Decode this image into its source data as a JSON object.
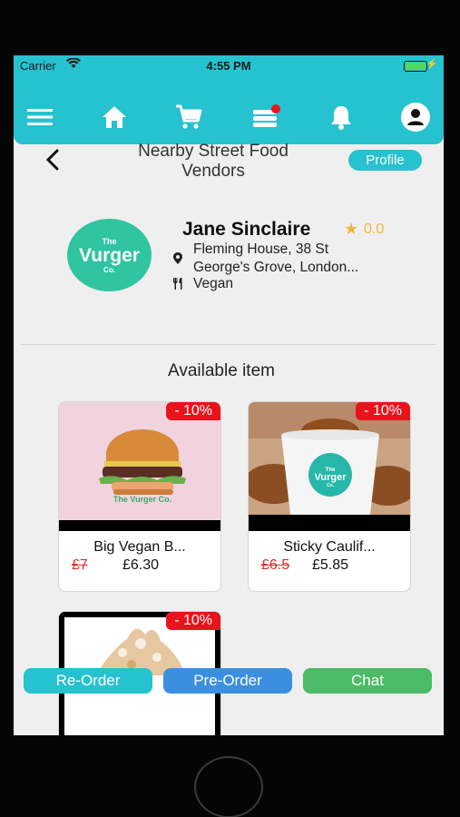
{
  "status_bar": {
    "carrier": "Carrier",
    "time": "4:55 PM"
  },
  "nav": {
    "icons": [
      "menu-icon",
      "home-icon",
      "cart-icon",
      "orders-icon",
      "bell-icon",
      "account-icon"
    ],
    "orders_badge_color": "#e8141c"
  },
  "header": {
    "title": "Nearby Street Food Vendors",
    "profile_label": "Profile"
  },
  "vendor": {
    "logo_text_small": "The",
    "logo_text_big": "Vurger",
    "logo_text_co": "Co.",
    "name": "Jane Sinclaire",
    "rating": "0.0",
    "address": "Fleming House, 38 St George's Grove, London...",
    "cuisine": "Vegan"
  },
  "section_title": "Available item",
  "items": [
    {
      "name": "Big Vegan B...",
      "old_price": "£7",
      "price": "£6.30",
      "discount": "- 10%"
    },
    {
      "name": "Sticky Caulif...",
      "old_price": "£6.5",
      "price": "£5.85",
      "discount": "- 10%"
    },
    {
      "name": "",
      "old_price": "",
      "price": "",
      "discount": "- 10%"
    }
  ],
  "actions": {
    "reorder": "Re-Order",
    "preorder": "Pre-Order",
    "chat": "Chat"
  },
  "colors": {
    "brand_teal": "#26c2cf",
    "logo_green": "#2fc5a0",
    "rating": "#f3b43a",
    "discount": "#e8141c",
    "reorder": "#26c2cf",
    "preorder": "#3a8fe0",
    "chat": "#4cbb67"
  }
}
